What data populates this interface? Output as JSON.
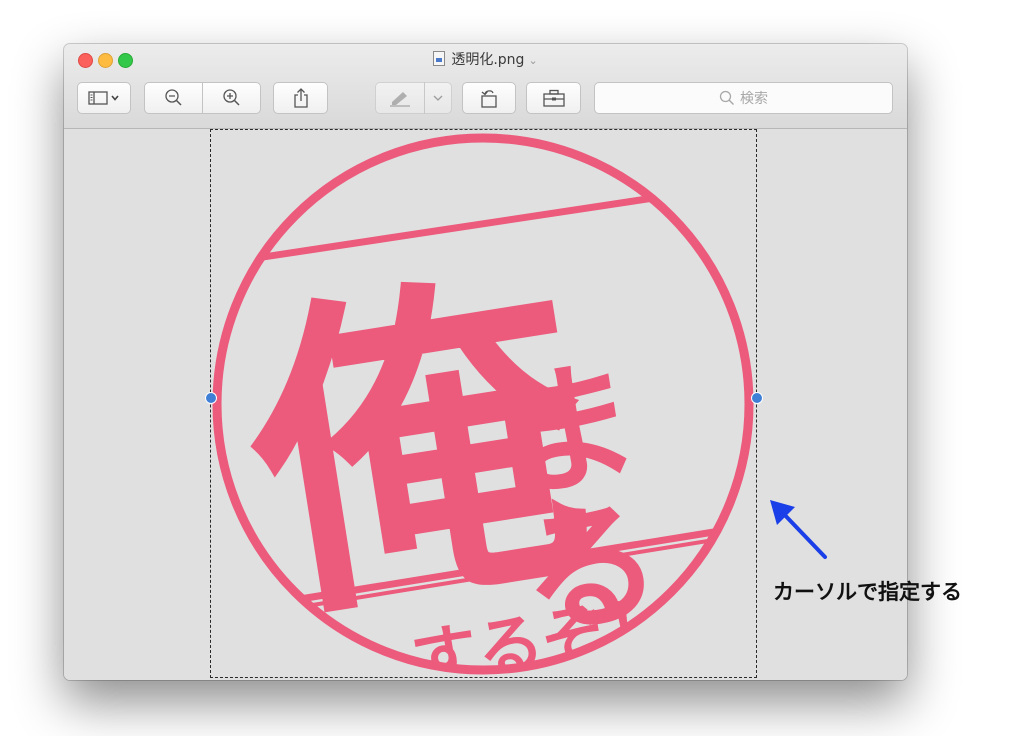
{
  "window": {
    "title": "透明化.png",
    "title_chevron": "⌄"
  },
  "toolbar": {
    "sidebar_button_icon": "sidebar-icon",
    "zoom_out_icon": "zoom-out-icon",
    "zoom_in_icon": "zoom-in-icon",
    "share_icon": "share-icon",
    "markup_icon": "markup-pen-icon",
    "rotate_icon": "rotate-icon",
    "toolbox_icon": "toolbox-icon",
    "search_placeholder": "検索"
  },
  "image": {
    "stamp_main_char": "俺",
    "stamp_side_chars": "まる",
    "stamp_bottom_text": "するぞ！",
    "stamp_color": "#ec5a7c"
  },
  "annotation": {
    "label": "カーソルで指定する",
    "arrow_color": "#1a3fe8"
  }
}
